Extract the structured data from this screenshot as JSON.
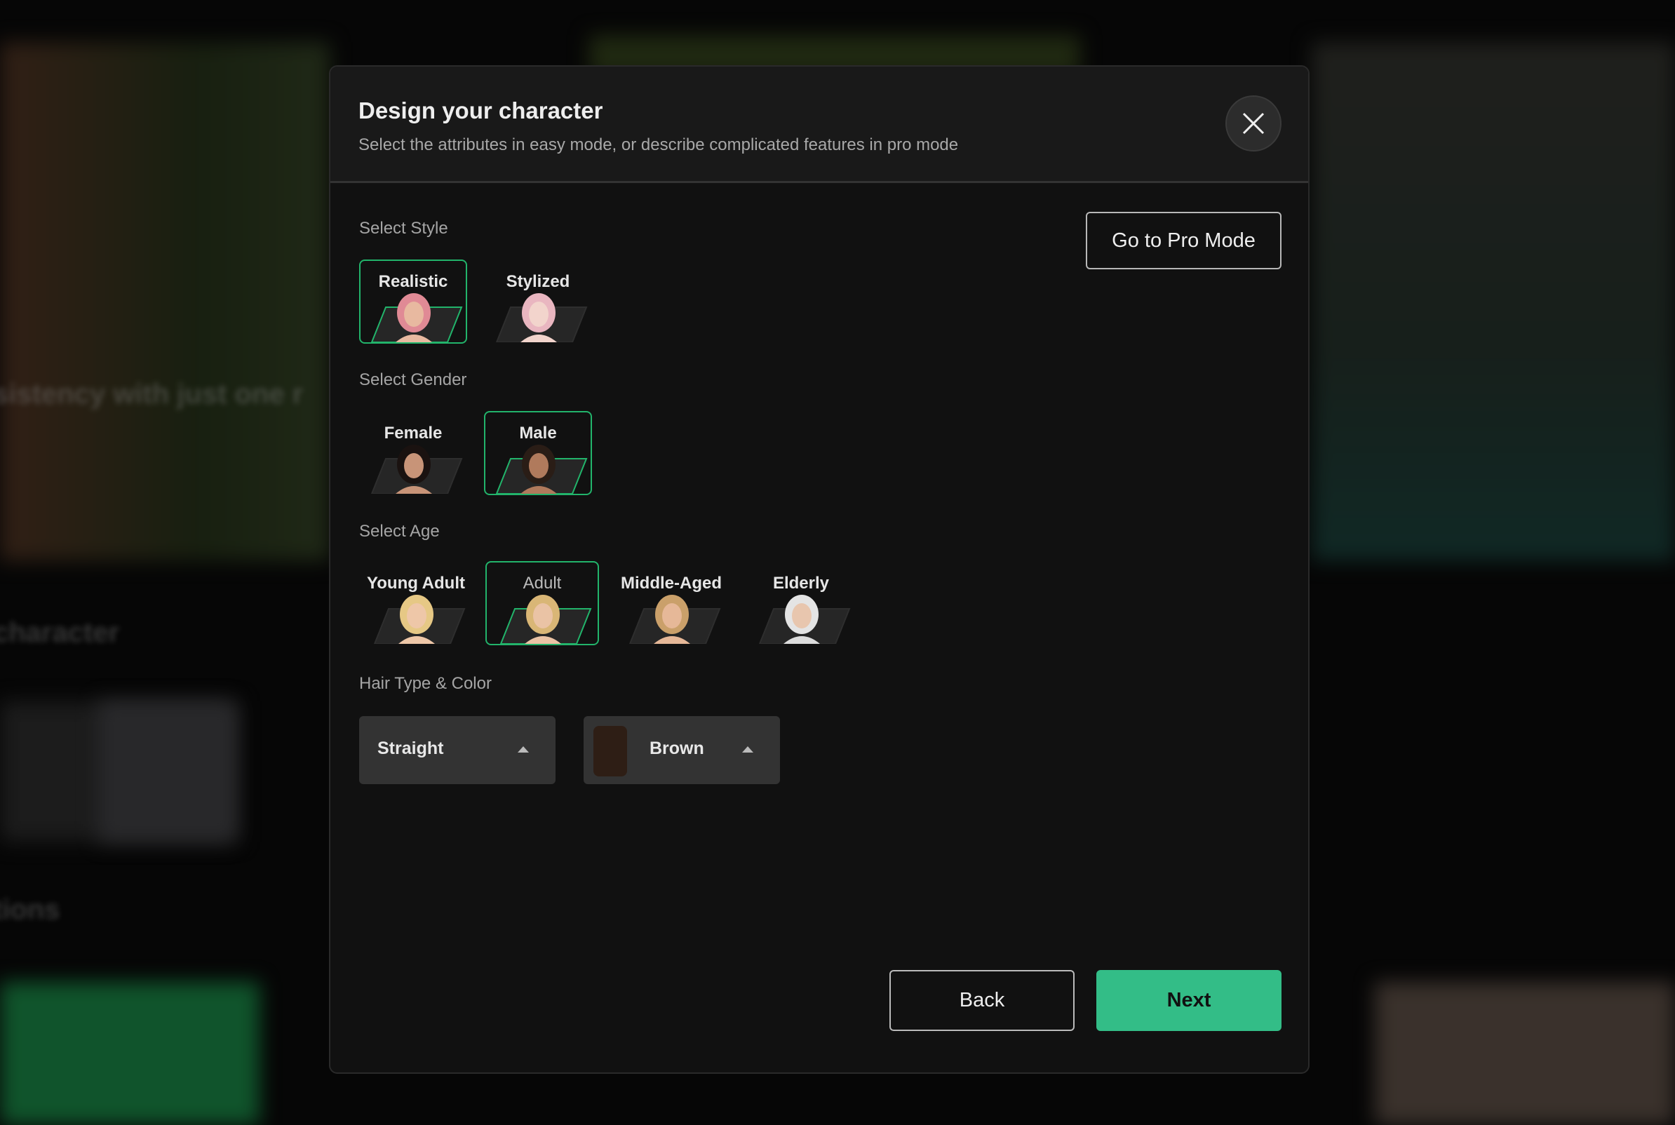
{
  "background": {
    "headline_fragment": "sistency with just one r",
    "section_fragment": "character",
    "section2_fragment": "tions"
  },
  "modal": {
    "title": "Design your character",
    "subtitle": "Select the attributes in easy mode, or describe complicated features in pro mode",
    "close_icon": "close-icon",
    "pro_button": "Go to Pro Mode",
    "style": {
      "label": "Select Style",
      "options": [
        "Realistic",
        "Stylized"
      ],
      "selected": "Realistic"
    },
    "gender": {
      "label": "Select Gender",
      "options": [
        "Female",
        "Male"
      ],
      "selected": "Male"
    },
    "age": {
      "label": "Select Age",
      "options": [
        "Young Adult",
        "Adult",
        "Middle-Aged",
        "Elderly"
      ],
      "selected": "Adult"
    },
    "hair": {
      "label": "Hair Type & Color",
      "type": "Straight",
      "color": "Brown",
      "color_hex": "#2e1e15"
    },
    "back_button": "Back",
    "next_button": "Next"
  },
  "colors": {
    "accent": "#33bd87",
    "selected_border": "#22b46b"
  }
}
